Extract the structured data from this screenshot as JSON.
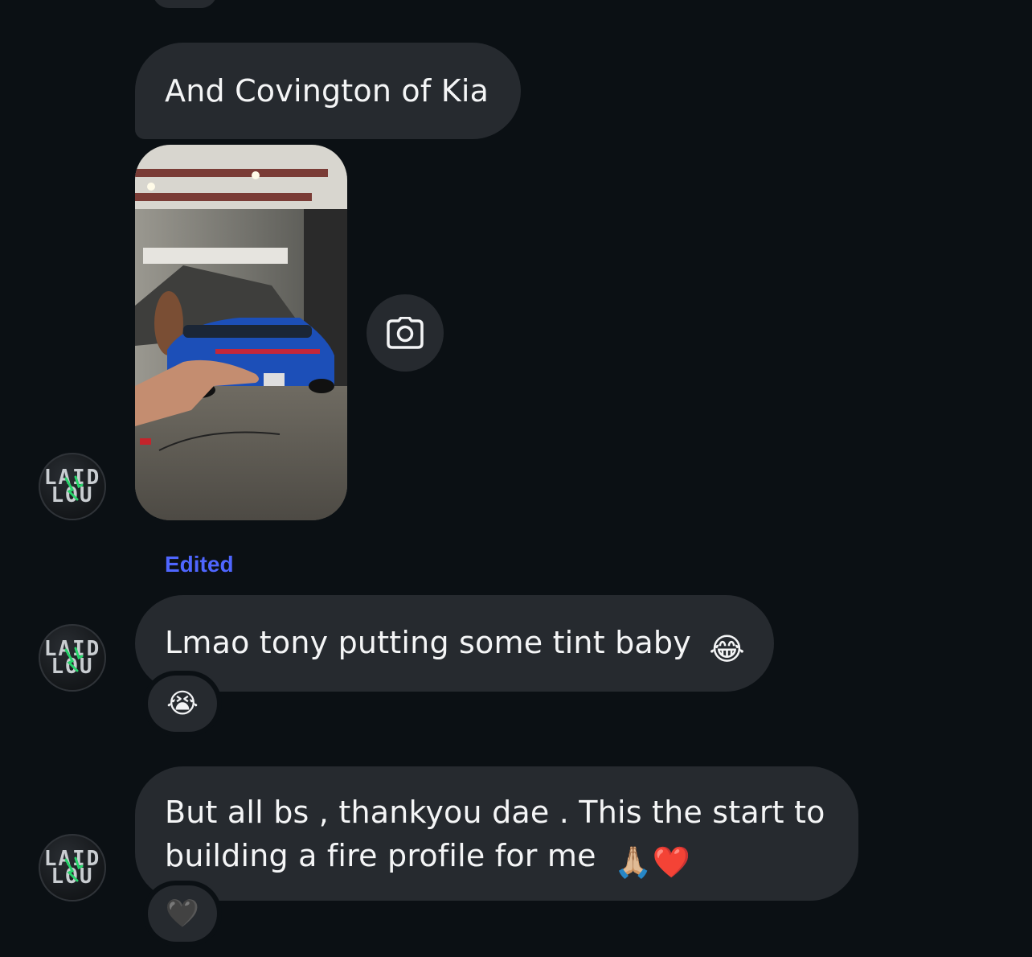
{
  "thread": {
    "messages": [
      {
        "text": "And Covington of Kia"
      },
      {
        "type": "photo"
      },
      {
        "status": "Edited",
        "text": "Lmao tony putting some tint baby",
        "emoji": "😂",
        "reaction": "😭"
      },
      {
        "line1": "But all bs , thankyou dae . This the start to",
        "line2": "building a fire profile for me",
        "emoji": "🙏🏼❤️",
        "reaction": "🖤"
      }
    ]
  },
  "avatar": {
    "line1": "LAID",
    "line2": "LOU"
  },
  "icons": {
    "camera": "camera-icon"
  },
  "colors": {
    "background": "#0b1014",
    "bubble": "#262a2f",
    "edited": "#4f66ff"
  }
}
